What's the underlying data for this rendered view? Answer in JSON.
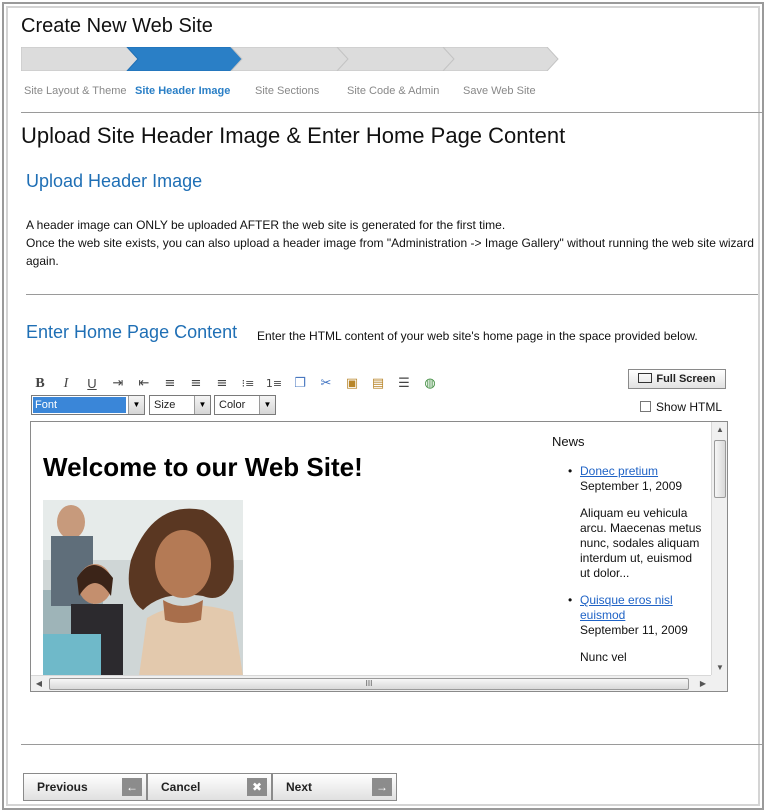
{
  "wizard": {
    "title": "Create New Web Site",
    "steps": [
      {
        "label": "Site Layout & Theme",
        "state": "done"
      },
      {
        "label": "Site Header Image",
        "state": "active"
      },
      {
        "label": "Site Sections",
        "state": "pending"
      },
      {
        "label": "Site Code & Admin",
        "state": "pending"
      },
      {
        "label": "Save Web Site",
        "state": "pending"
      }
    ],
    "colors": {
      "active": "#2a7fc6",
      "inactive": "#dcdcdc",
      "heading": "#1f6fb5"
    }
  },
  "page": {
    "heading": "Upload Site Header Image & Enter Home Page Content"
  },
  "header_image": {
    "title": "Upload Header Image",
    "line1": "A header image can ONLY be uploaded AFTER the web site is generated for the first time.",
    "line2": "Once the web site exists, you can also upload a header image from \"Administration -> Image Gallery\" without running the web site wizard again."
  },
  "home_content": {
    "title": "Enter Home Page Content",
    "note": "Enter the HTML content of your web site's home page in the space provided below."
  },
  "editor": {
    "toolbar_icons": [
      "bold-icon",
      "italic-icon",
      "underline-icon",
      "indent-icon",
      "outdent-icon",
      "align-left-icon",
      "align-center-icon",
      "align-right-icon",
      "bullet-list-icon",
      "numbered-list-icon",
      "copy-icon",
      "cut-icon",
      "paste-icon",
      "paste-word-icon",
      "insert-rule-icon",
      "insert-image-icon"
    ],
    "font_select": "Font",
    "size_select": "Size",
    "color_select": "Color",
    "full_screen_label": "Full Screen",
    "show_html_label": "Show HTML",
    "content": {
      "heading": "Welcome to our Web Site!",
      "news_title": "News",
      "news": [
        {
          "link": "Donec pretium",
          "date": "September 1, 2009",
          "excerpt": "Aliquam eu vehicula arcu. Maecenas metus nunc, sodales aliquam interdum ut, euismod ut dolor..."
        },
        {
          "link": "Quisque eros nisl euismod",
          "date": "September 11, 2009",
          "excerpt": "Nunc vel"
        }
      ]
    },
    "scroll_thumb_glyph": "III"
  },
  "nav": {
    "previous": "Previous",
    "cancel": "Cancel",
    "next": "Next"
  }
}
